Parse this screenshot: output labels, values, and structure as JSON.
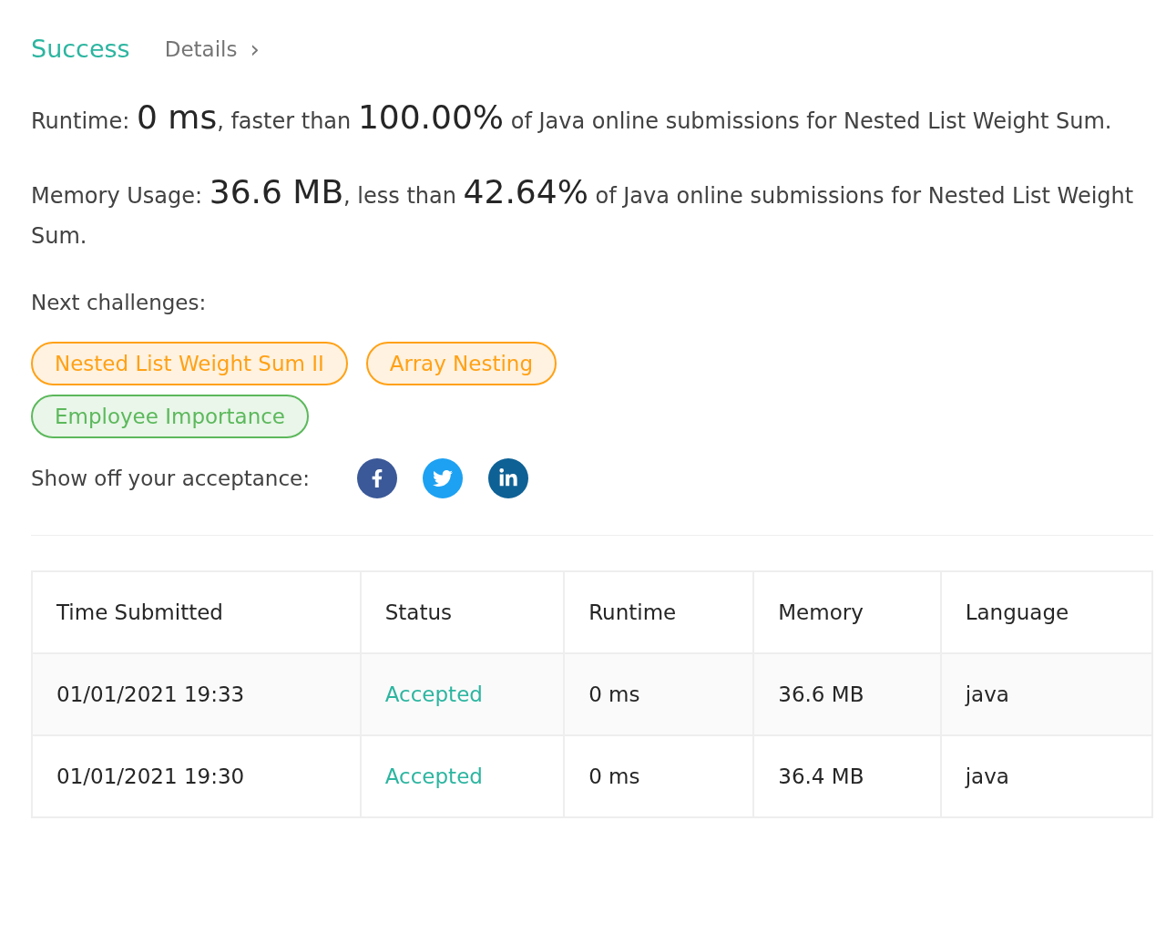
{
  "header": {
    "status": "Success",
    "details": "Details",
    "details_arrow": "›"
  },
  "runtime": [
    {
      "text": "Runtime: ",
      "big": false
    },
    {
      "text": "0 ms",
      "big": true
    },
    {
      "text": ", faster than ",
      "big": false
    },
    {
      "text": "100.00%",
      "big": true
    },
    {
      "text": " of Java online submissions for Nested List Weight Sum.",
      "big": false
    }
  ],
  "memory": [
    {
      "text": "Memory Usage: ",
      "big": false
    },
    {
      "text": "36.6 MB",
      "big": true
    },
    {
      "text": ", less than ",
      "big": false
    },
    {
      "text": "42.64%",
      "big": true
    },
    {
      "text": " of Java online submissions for Nested List Weight Sum.",
      "big": false
    }
  ],
  "next_challenges": {
    "label": "Next challenges:",
    "items": [
      {
        "title": "Nested List Weight Sum II",
        "color": "#ffa116"
      },
      {
        "title": "Array Nesting",
        "color": "#ffa116"
      },
      {
        "title": "Employee Importance",
        "color": "#5cb85c"
      }
    ]
  },
  "share": {
    "label": "Show off your acceptance:",
    "buttons": [
      {
        "kind": "facebook"
      },
      {
        "kind": "twitter"
      },
      {
        "kind": "linkedin"
      }
    ]
  },
  "table": {
    "columns": [
      "Time Submitted",
      "Status",
      "Runtime",
      "Memory",
      "Language"
    ],
    "rows": [
      [
        "01/01/2021 19:33",
        "Accepted",
        "0 ms",
        "36.6 MB",
        "java"
      ],
      [
        "01/01/2021 19:30",
        "Accepted",
        "0 ms",
        "36.4 MB",
        "java"
      ]
    ]
  }
}
